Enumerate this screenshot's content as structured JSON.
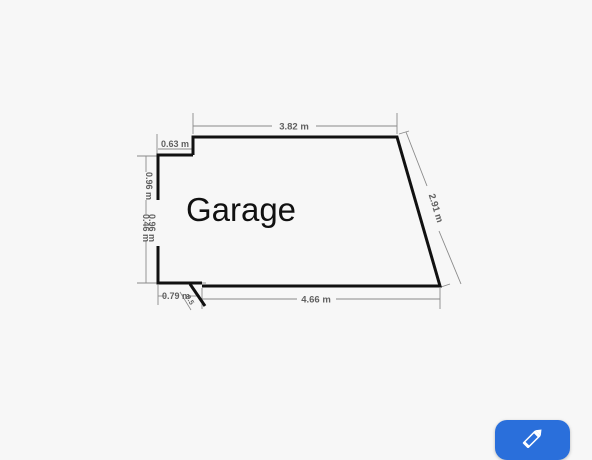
{
  "room": {
    "name": "Garage",
    "wall_lengths": {
      "top": "3.82 m",
      "slanted_right": "2.91 m",
      "bottom": "4.66 m",
      "notch_top": "0.63 m",
      "left_upper": "0.96 m",
      "left_middle": "0.46 m",
      "left_lower": "0.96 m",
      "notch_bottom": "0.79 m",
      "door_small": "0.5"
    }
  },
  "toolbar": {
    "edit_icon": "pencil-icon",
    "accent_color": "#2a6fdb"
  }
}
